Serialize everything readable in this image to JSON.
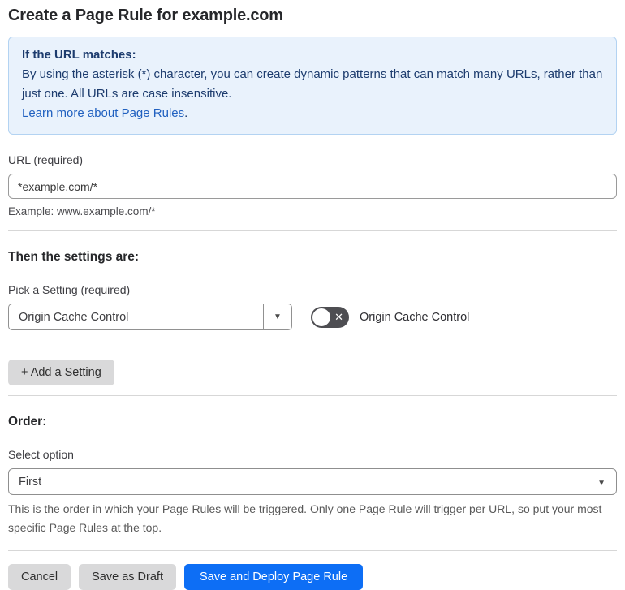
{
  "page": {
    "title": "Create a Page Rule for example.com"
  },
  "info_box": {
    "heading": "If the URL matches:",
    "body": "By using the asterisk (*) character, you can create dynamic patterns that can match many URLs, rather than just one. All URLs are case insensitive.",
    "link": "Learn more about Page Rules",
    "link_suffix": ".",
    "bg_color": "#e9f2fc",
    "border_color": "#b3d3f2",
    "text_color": "#1d3c6e",
    "link_color": "#2161c0"
  },
  "url_section": {
    "label": "URL (required)",
    "value": "*example.com/*",
    "example": "Example: www.example.com/*"
  },
  "settings_section": {
    "heading": "Then the settings are:",
    "pick_label": "Pick a Setting (required)",
    "selected_setting": "Origin Cache Control",
    "toggle_state": "off",
    "toggle_label": "Origin Cache Control",
    "add_button_label": "+ Add a Setting"
  },
  "order_section": {
    "heading": "Order:",
    "label": "Select option",
    "selected_option": "First",
    "help": "This is the order in which your Page Rules will be triggered. Only one Page Rule will trigger per URL, so put your most specific Page Rules at the top."
  },
  "footer": {
    "cancel_label": "Cancel",
    "save_draft_label": "Save as Draft",
    "save_deploy_label": "Save and Deploy Page Rule",
    "primary_color": "#0d6ef5",
    "secondary_color": "#d9d9da"
  },
  "icons": {
    "dropdown_arrow": "▼",
    "toggle_x": "✕"
  }
}
